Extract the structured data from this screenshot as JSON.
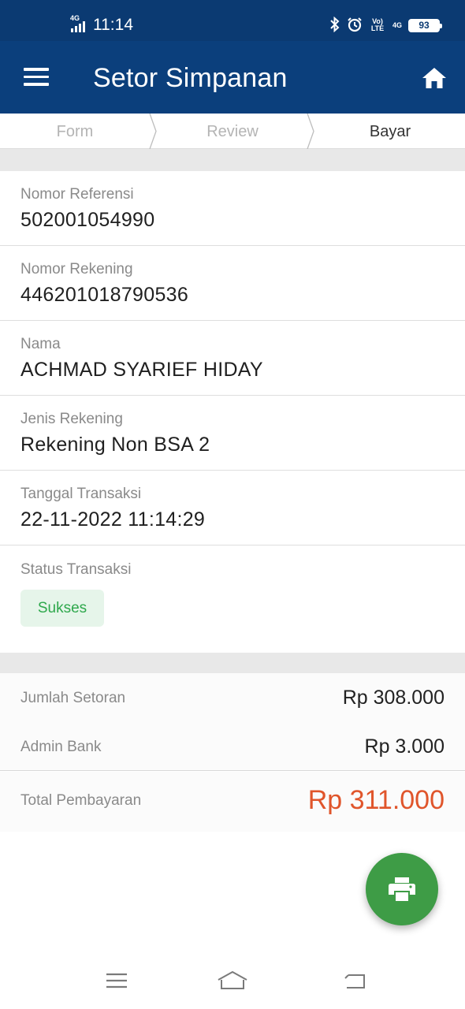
{
  "status_bar": {
    "network": "4G",
    "time": "11:14",
    "volte": "Vo) LTE",
    "network_right": "4G",
    "battery": "93",
    "icons": [
      "signal-icon",
      "bluetooth-icon",
      "alarm-icon",
      "battery-icon"
    ]
  },
  "app_bar": {
    "title": "Setor Simpanan",
    "icons": [
      "menu-icon",
      "home-icon"
    ]
  },
  "steps": [
    "Form",
    "Review",
    "Bayar"
  ],
  "active_step": "Bayar",
  "details": [
    {
      "label": "Nomor Referensi",
      "value": "502001054990"
    },
    {
      "label": "Nomor Rekening",
      "value": "446201018790536"
    },
    {
      "label": "Nama",
      "value": "ACHMAD SYARIEF HIDAY"
    },
    {
      "label": "Jenis Rekening",
      "value": "Rekening Non BSA 2"
    },
    {
      "label": "Tanggal Transaksi",
      "value": "22-11-2022 11:14:29"
    }
  ],
  "status": {
    "label": "Status Transaksi",
    "value": "Sukses",
    "color": "#2ea84c"
  },
  "summary": [
    {
      "label": "Jumlah Setoran",
      "value": "Rp 308.000"
    },
    {
      "label": "Admin Bank",
      "value": "Rp 3.000"
    }
  ],
  "total": {
    "label": "Total Pembayaran",
    "value": "Rp 311.000",
    "color": "#e0552b"
  },
  "fab_icon": "print-icon",
  "colors": {
    "primary": "#0b3f7c",
    "statusbar": "#0b3a72",
    "fab": "#3e9c46"
  }
}
